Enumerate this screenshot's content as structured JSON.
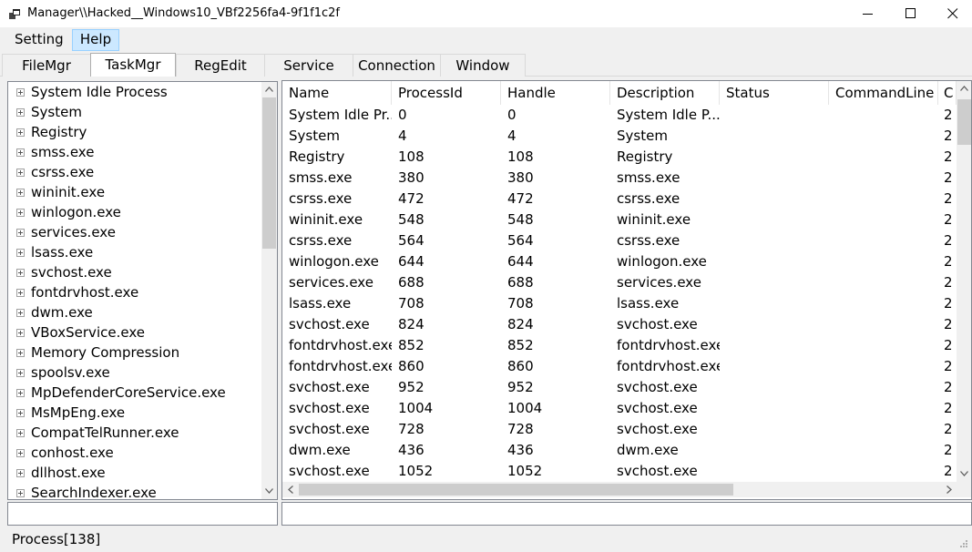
{
  "window": {
    "title": "Manager\\\\Hacked__Windows10_VBf2256fa4-9f1f1c2f"
  },
  "menu": [
    {
      "label": "Setting"
    },
    {
      "label": "Help"
    }
  ],
  "tabs": [
    {
      "label": "FileMgr"
    },
    {
      "label": "TaskMgr"
    },
    {
      "label": "RegEdit"
    },
    {
      "label": "Service"
    },
    {
      "label": "Connection"
    },
    {
      "label": "Window"
    }
  ],
  "active_tab": "TaskMgr",
  "tree": {
    "items": [
      "System Idle Process",
      "System",
      "Registry",
      "smss.exe",
      "csrss.exe",
      "wininit.exe",
      "winlogon.exe",
      "services.exe",
      "lsass.exe",
      "svchost.exe",
      "fontdrvhost.exe",
      "dwm.exe",
      "VBoxService.exe",
      "Memory Compression",
      "spoolsv.exe",
      "MpDefenderCoreService.exe",
      "MsMpEng.exe",
      "CompatTelRunner.exe",
      "conhost.exe",
      "dllhost.exe",
      "SearchIndexer.exe"
    ]
  },
  "process_list": {
    "columns": [
      "Name",
      "ProcessId",
      "Handle",
      "Description",
      "Status",
      "CommandLine",
      "C"
    ],
    "rows": [
      [
        "System Idle Pr...",
        "0",
        "0",
        "System Idle P...",
        "",
        "",
        "2"
      ],
      [
        "System",
        "4",
        "4",
        "System",
        "",
        "",
        "2"
      ],
      [
        "Registry",
        "108",
        "108",
        "Registry",
        "",
        "",
        "2"
      ],
      [
        "smss.exe",
        "380",
        "380",
        "smss.exe",
        "",
        "",
        "2"
      ],
      [
        "csrss.exe",
        "472",
        "472",
        "csrss.exe",
        "",
        "",
        "2"
      ],
      [
        "wininit.exe",
        "548",
        "548",
        "wininit.exe",
        "",
        "",
        "2"
      ],
      [
        "csrss.exe",
        "564",
        "564",
        "csrss.exe",
        "",
        "",
        "2"
      ],
      [
        "winlogon.exe",
        "644",
        "644",
        "winlogon.exe",
        "",
        "",
        "2"
      ],
      [
        "services.exe",
        "688",
        "688",
        "services.exe",
        "",
        "",
        "2"
      ],
      [
        "lsass.exe",
        "708",
        "708",
        "lsass.exe",
        "",
        "",
        "2"
      ],
      [
        "svchost.exe",
        "824",
        "824",
        "svchost.exe",
        "",
        "",
        "2"
      ],
      [
        "fontdrvhost.exe",
        "852",
        "852",
        "fontdrvhost.exe",
        "",
        "",
        "2"
      ],
      [
        "fontdrvhost.exe",
        "860",
        "860",
        "fontdrvhost.exe",
        "",
        "",
        "2"
      ],
      [
        "svchost.exe",
        "952",
        "952",
        "svchost.exe",
        "",
        "",
        "2"
      ],
      [
        "svchost.exe",
        "1004",
        "1004",
        "svchost.exe",
        "",
        "",
        "2"
      ],
      [
        "svchost.exe",
        "728",
        "728",
        "svchost.exe",
        "",
        "",
        "2"
      ],
      [
        "dwm.exe",
        "436",
        "436",
        "dwm.exe",
        "",
        "",
        "2"
      ],
      [
        "svchost.exe",
        "1052",
        "1052",
        "svchost.exe",
        "",
        "",
        "2"
      ]
    ]
  },
  "status": {
    "text": "Process[138]"
  },
  "colors": {
    "menu_highlight": "#cce8ff",
    "menu_highlight_border": "#99d1ff",
    "scroll_thumb": "#cdcdcd"
  },
  "icons": {
    "app": "app-window-icon",
    "minimize": "minimize-icon",
    "maximize": "maximize-icon",
    "close": "close-icon",
    "expander": "plus-expander-icon"
  }
}
